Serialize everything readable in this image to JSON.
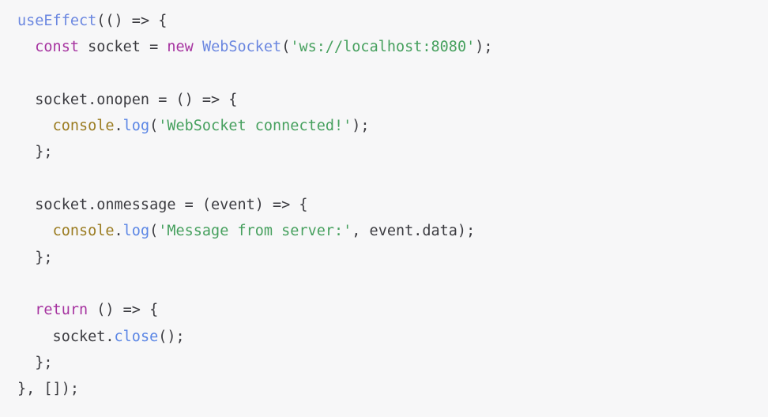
{
  "editor": {
    "language": "javascript",
    "background_color": "#f7f7f8",
    "default_text_color": "#3b3b40",
    "font_size_px": 18.5,
    "line_height_px": 33.3,
    "line_count": 15,
    "palette": {
      "keyword": "#a633a0",
      "function": "#6b87e0",
      "method": "#5b86e5",
      "string": "#46a05e",
      "object": "#9a7b1f",
      "plain": "#3b3b40"
    }
  },
  "code": {
    "lines": [
      {
        "index": 1,
        "text": "useEffect(() => {",
        "tokens": [
          {
            "t": "useEffect",
            "c": "function"
          },
          {
            "t": "(() => {",
            "c": "plain"
          }
        ]
      },
      {
        "index": 2,
        "text": "  const socket = new WebSocket('ws://localhost:8080');",
        "tokens": [
          {
            "t": "  ",
            "c": "plain"
          },
          {
            "t": "const",
            "c": "keyword"
          },
          {
            "t": " socket = ",
            "c": "plain"
          },
          {
            "t": "new",
            "c": "keyword"
          },
          {
            "t": " ",
            "c": "plain"
          },
          {
            "t": "WebSocket",
            "c": "function"
          },
          {
            "t": "(",
            "c": "plain"
          },
          {
            "t": "'ws://localhost:8080'",
            "c": "string"
          },
          {
            "t": ");",
            "c": "plain"
          }
        ]
      },
      {
        "index": 3,
        "text": "",
        "tokens": [
          {
            "t": " ",
            "c": "plain"
          }
        ]
      },
      {
        "index": 4,
        "text": "  socket.onopen = () => {",
        "tokens": [
          {
            "t": "  socket.onopen = () => {",
            "c": "plain"
          }
        ]
      },
      {
        "index": 5,
        "text": "    console.log('WebSocket connected!');",
        "tokens": [
          {
            "t": "    ",
            "c": "plain"
          },
          {
            "t": "console",
            "c": "object"
          },
          {
            "t": ".",
            "c": "plain"
          },
          {
            "t": "log",
            "c": "method"
          },
          {
            "t": "(",
            "c": "plain"
          },
          {
            "t": "'WebSocket connected!'",
            "c": "string"
          },
          {
            "t": ");",
            "c": "plain"
          }
        ]
      },
      {
        "index": 6,
        "text": "  };",
        "tokens": [
          {
            "t": "  };",
            "c": "plain"
          }
        ]
      },
      {
        "index": 7,
        "text": "",
        "tokens": [
          {
            "t": " ",
            "c": "plain"
          }
        ]
      },
      {
        "index": 8,
        "text": "  socket.onmessage = (event) => {",
        "tokens": [
          {
            "t": "  socket.onmessage = (event) => {",
            "c": "plain"
          }
        ]
      },
      {
        "index": 9,
        "text": "    console.log('Message from server:', event.data);",
        "tokens": [
          {
            "t": "    ",
            "c": "plain"
          },
          {
            "t": "console",
            "c": "object"
          },
          {
            "t": ".",
            "c": "plain"
          },
          {
            "t": "log",
            "c": "method"
          },
          {
            "t": "(",
            "c": "plain"
          },
          {
            "t": "'Message from server:'",
            "c": "string"
          },
          {
            "t": ", event.data);",
            "c": "plain"
          }
        ]
      },
      {
        "index": 10,
        "text": "  };",
        "tokens": [
          {
            "t": "  };",
            "c": "plain"
          }
        ]
      },
      {
        "index": 11,
        "text": "",
        "tokens": [
          {
            "t": " ",
            "c": "plain"
          }
        ]
      },
      {
        "index": 12,
        "text": "  return () => {",
        "tokens": [
          {
            "t": "  ",
            "c": "plain"
          },
          {
            "t": "return",
            "c": "keyword"
          },
          {
            "t": " () => {",
            "c": "plain"
          }
        ]
      },
      {
        "index": 13,
        "text": "    socket.close();",
        "tokens": [
          {
            "t": "    socket.",
            "c": "plain"
          },
          {
            "t": "close",
            "c": "method"
          },
          {
            "t": "();",
            "c": "plain"
          }
        ]
      },
      {
        "index": 14,
        "text": "  };",
        "tokens": [
          {
            "t": "  };",
            "c": "plain"
          }
        ]
      },
      {
        "index": 15,
        "text": "}, []);",
        "tokens": [
          {
            "t": "}, []);",
            "c": "plain"
          }
        ]
      }
    ]
  }
}
